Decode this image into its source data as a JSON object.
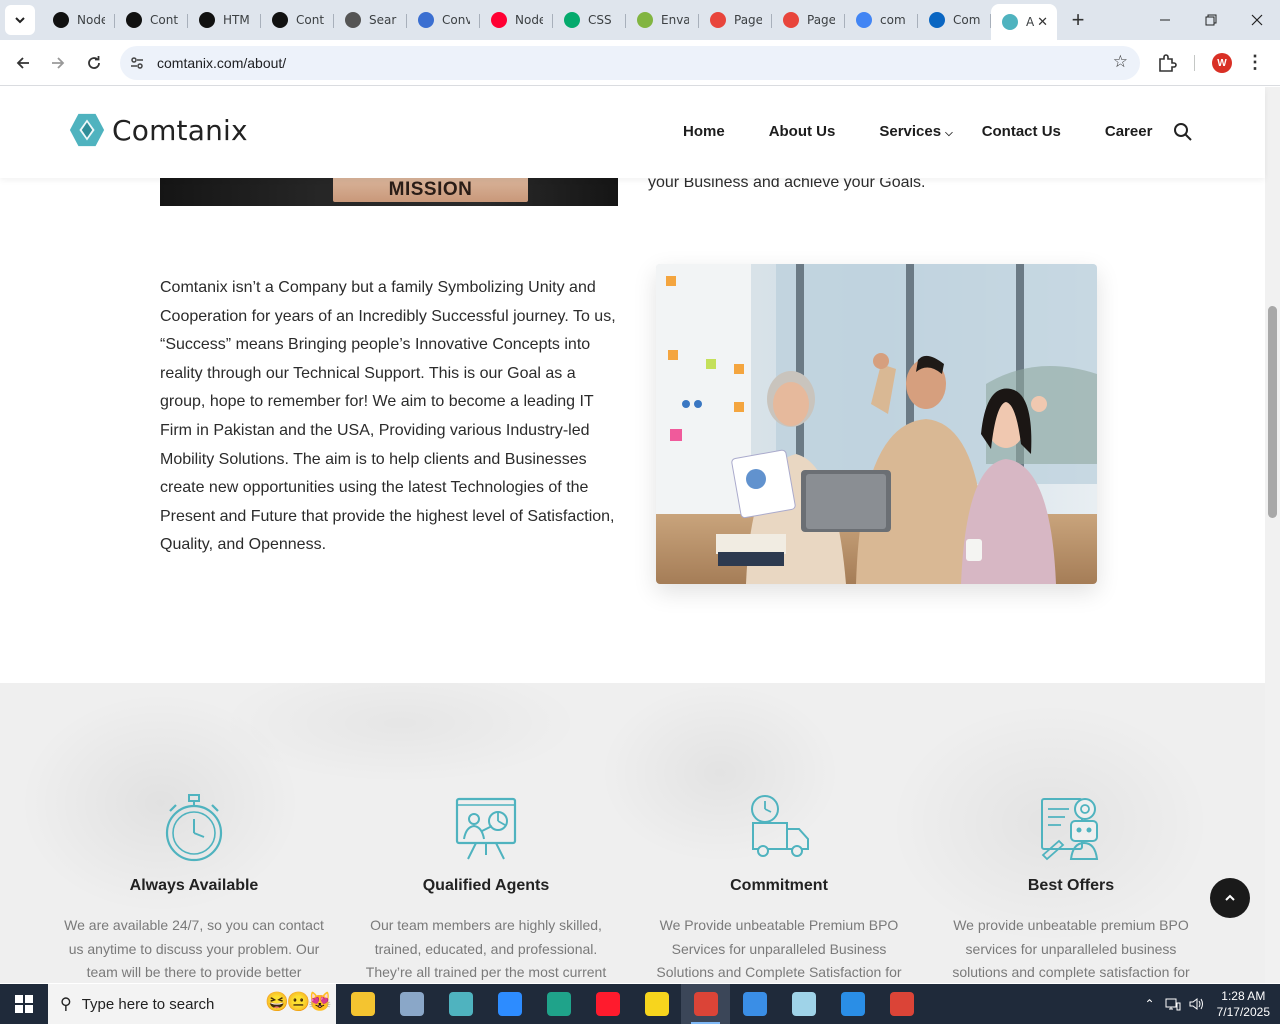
{
  "browser": {
    "tabs": [
      {
        "label": "Node",
        "icon": "github-icon",
        "color": "#111111"
      },
      {
        "label": "Cont",
        "icon": "github-icon",
        "color": "#111111"
      },
      {
        "label": "HTM",
        "icon": "github-icon",
        "color": "#111111"
      },
      {
        "label": "Cont",
        "icon": "github-icon",
        "color": "#111111"
      },
      {
        "label": "Sear",
        "icon": "wordpress-icon",
        "color": "#555555"
      },
      {
        "label": "Conv",
        "icon": "converter-icon",
        "color": "#3b6fd1"
      },
      {
        "label": "Node",
        "icon": "youtube-icon",
        "color": "#ff0033"
      },
      {
        "label": "CSS",
        "icon": "w3schools-icon",
        "color": "#04aa6d"
      },
      {
        "label": "Enva",
        "icon": "envato-icon",
        "color": "#82b541"
      },
      {
        "label": "Page",
        "icon": "pagespeed-icon",
        "color": "#e8453c"
      },
      {
        "label": "Page",
        "icon": "pagespeed-icon",
        "color": "#e8453c"
      },
      {
        "label": "com",
        "icon": "google-icon",
        "color": "#4285f4"
      },
      {
        "label": "Com",
        "icon": "linkedin-icon",
        "color": "#0a66c2"
      },
      {
        "label": "A",
        "icon": "comtanix-icon",
        "color": "#4fb3bf",
        "active": true
      }
    ],
    "url": "comtanix.com/about/",
    "profile_initial": "W"
  },
  "site": {
    "logo_text": "Comtanix",
    "brand_color": "#4fb3bf",
    "nav": [
      "Home",
      "About Us",
      "Services",
      "Contact Us",
      "Career"
    ],
    "mission_label": "MISSION",
    "mission_tail": "your Business and achieve your Goals.",
    "about_paragraph": "Comtanix isn’t a Company but a family Symbolizing Unity and Cooperation for years of an Incredibly Successful journey. To us, “Success” means Bringing people’s Innovative Concepts into reality through our Technical Support. This is our Goal as a group, hope to remember for! We aim to become a leading IT Firm in Pakistan and the USA, Providing various Industry-led Mobility Solutions. The aim is to help clients and Businesses create new opportunities using the latest Technologies of the Present and Future that provide the highest level of Satisfaction, Quality, and Openness.",
    "features": [
      {
        "title": "Always Available",
        "icon": "stopwatch-icon",
        "text": "We are available 24/7, so you can contact us anytime to discuss your problem. Our team will be there to provide better"
      },
      {
        "title": "Qualified Agents",
        "icon": "presentation-agent-icon",
        "text": "Our team members are highly skilled, trained, educated, and professional. They’re all trained per the most current"
      },
      {
        "title": "Commitment",
        "icon": "delivery-truck-clock-icon",
        "text": "We Provide unbeatable Premium BPO Services for unparalleled Business Solutions and Complete Satisfaction for"
      },
      {
        "title": "Best Offers",
        "icon": "robot-blueprint-icon",
        "text": "We provide unbeatable premium BPO services for unparalleled business solutions and complete satisfaction for"
      }
    ]
  },
  "taskbar": {
    "search_placeholder": "Type here to search",
    "time": "1:28 AM",
    "date": "7/17/2025",
    "apps": [
      {
        "name": "file-explorer",
        "color": "#f4c430"
      },
      {
        "name": "paint-app",
        "color": "#8aa7c8"
      },
      {
        "name": "comtanix-app",
        "color": "#4fb3bf"
      },
      {
        "name": "zoom-app",
        "color": "#2d8cff"
      },
      {
        "name": "edge-browser",
        "color": "#1fa38a"
      },
      {
        "name": "opera-browser",
        "color": "#ff1b2d"
      },
      {
        "name": "sticky-notes",
        "color": "#f7d51d"
      },
      {
        "name": "chrome-browser",
        "color": "#db4437",
        "active": true
      },
      {
        "name": "photos-app",
        "color": "#3a8ee6"
      },
      {
        "name": "notepad-app",
        "color": "#9fd3e8"
      },
      {
        "name": "vscode-app",
        "color": "#2a8ee6"
      },
      {
        "name": "chrome-browser-2",
        "color": "#db4437"
      }
    ]
  }
}
